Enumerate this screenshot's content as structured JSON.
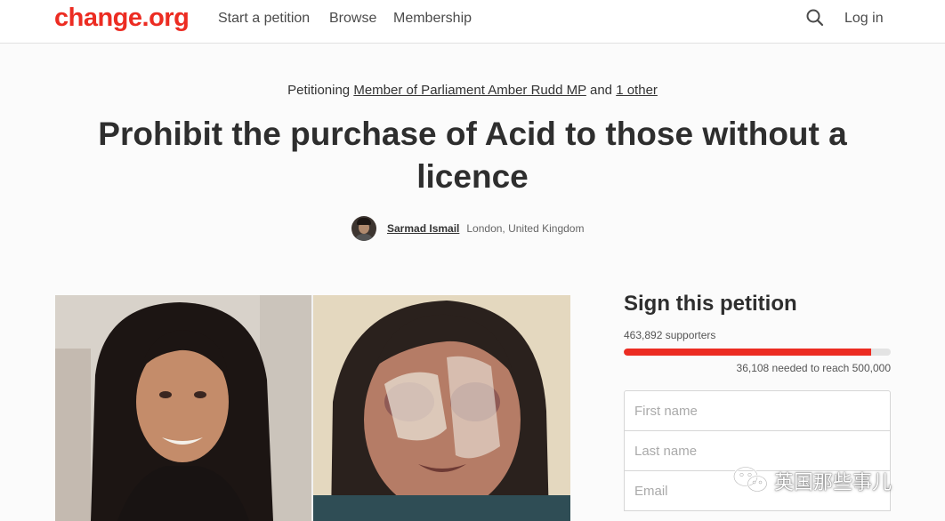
{
  "header": {
    "logo": "change.org",
    "nav": [
      "Start a petition",
      "Browse",
      "Membership"
    ],
    "search_icon": "search-icon",
    "login_label": "Log in",
    "brand_color": "#ec2c22"
  },
  "petition": {
    "petitioning_prefix": "Petitioning",
    "target": "Member of Parliament Amber Rudd MP",
    "conjunction": "and",
    "other_targets": "1 other",
    "title": "Prohibit the purchase of Acid to those without a licence",
    "author": {
      "name": "Sarmad Ismail",
      "location": "London, United Kingdom"
    }
  },
  "sign": {
    "title": "Sign this petition",
    "supporters": "463,892 supporters",
    "progress_fraction": 0.9278,
    "needed": "36,108 needed to reach 500,000",
    "fields": {
      "first_name_placeholder": "First name",
      "last_name_placeholder": "Last name",
      "email_placeholder": "Email"
    }
  },
  "watermark": {
    "text": "英国那些事儿",
    "icon": "wechat-icon"
  }
}
